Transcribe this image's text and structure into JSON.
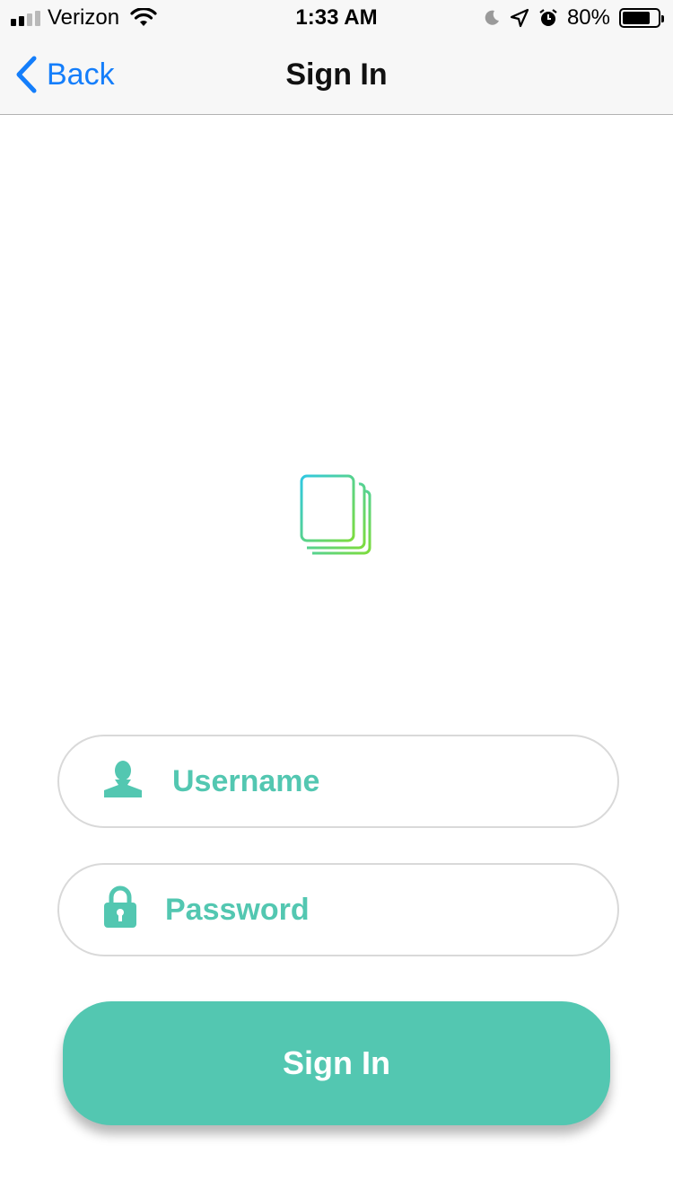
{
  "status_bar": {
    "carrier": "Verizon",
    "time": "1:33 AM",
    "battery_percent": "80%",
    "icons": [
      "signal-icon",
      "wifi-icon",
      "moon-icon",
      "location-arrow-icon",
      "alarm-icon",
      "battery-icon"
    ]
  },
  "nav": {
    "back_label": "Back",
    "title": "Sign In"
  },
  "form": {
    "username_placeholder": "Username",
    "password_placeholder": "Password",
    "submit_label": "Sign In"
  },
  "colors": {
    "accent": "#53c7b1",
    "ios_blue": "#147efb"
  }
}
